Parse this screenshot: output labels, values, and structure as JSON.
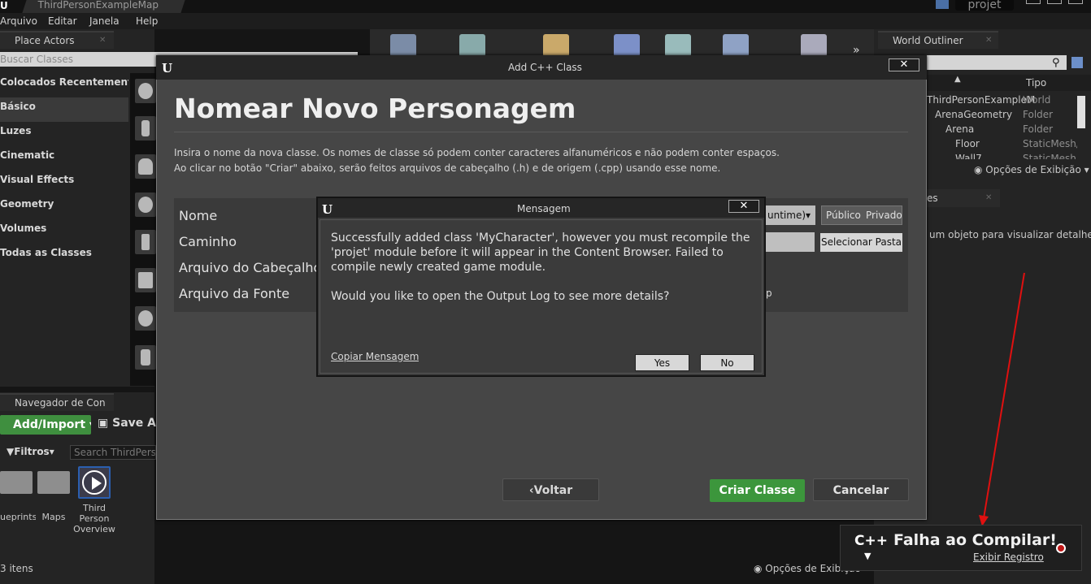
{
  "window": {
    "map_tab": "ThirdPersonExampleMap",
    "project": "projet"
  },
  "menu": [
    "Arquivo",
    "Editar",
    "Janela",
    "Help"
  ],
  "place_actors": {
    "tab": "Place Actors",
    "search_placeholder": "Buscar Classes",
    "categories": [
      "Colocados Recentemente",
      "Básico",
      "Luzes",
      "Cinematic",
      "Visual Effects",
      "Geometry",
      "Volumes",
      "Todas as Classes"
    ]
  },
  "content_browser": {
    "tab": "Navegador de Con",
    "add_import": "Add/Import",
    "save_all": "Save Al",
    "filters": "Filtros",
    "search_placeholder": "Search ThirdPerso",
    "items": [
      "ueprints",
      "Maps",
      "Third Person Overview"
    ],
    "item_count": "3 itens",
    "view_options": "Opções de Exibição"
  },
  "world_outliner": {
    "tab": "World Outliner",
    "column_type": "Tipo",
    "rows": [
      {
        "label": "ThirdPersonExampleM",
        "type": "World"
      },
      {
        "label": "ArenaGeometry",
        "type": "Folder"
      },
      {
        "label": "Arena",
        "type": "Folder"
      },
      {
        "label": "Floor",
        "type": "StaticMesh/"
      },
      {
        "label": "Wall7",
        "type": "StaticMesh/"
      }
    ],
    "view_options": "Opções de Exibição",
    "details_tab": "es",
    "details_msg": "um objeto para visualizar detalhes."
  },
  "add_class_dialog": {
    "title": "Add C++ Class",
    "heading": "Nomear Novo Personagem",
    "instructions_1": "Insira o nome da nova classe. Os nomes de classe só podem conter caracteres alfanuméricos e não podem conter espaços.",
    "instructions_2": "Ao clicar no botão \"Criar\" abaixo, serão feitos arquivos de cabeçalho (.h) e de origem (.cpp) usando esse nome.",
    "labels": {
      "name": "Nome",
      "path": "Caminho",
      "header": "Arquivo do Cabeçalho",
      "source": "Arquivo da Fonte"
    },
    "module": "untime)",
    "public": "Público",
    "private": "Privado",
    "select_folder": "Selecionar Pasta",
    "source_suffix": "p",
    "back": "Voltar",
    "create": "Criar Classe",
    "cancel": "Cancelar"
  },
  "message_box": {
    "title": "Mensagem",
    "text_1": "Successfully added class 'MyCharacter', however you must recompile the 'projet' module before it will appear in the Content Browser. Failed to compile newly created game module.",
    "text_2": "Would you like to open the Output Log to see more details?",
    "copy": "Copiar Mensagem",
    "yes": "Yes",
    "no": "No"
  },
  "toast": {
    "badge": "C++",
    "message": "Falha ao Compilar!",
    "link": "Exibir Registro"
  },
  "colors": {
    "accent_green": "#3c963c",
    "error_red": "#c01818",
    "arrow_red": "#e01010"
  }
}
